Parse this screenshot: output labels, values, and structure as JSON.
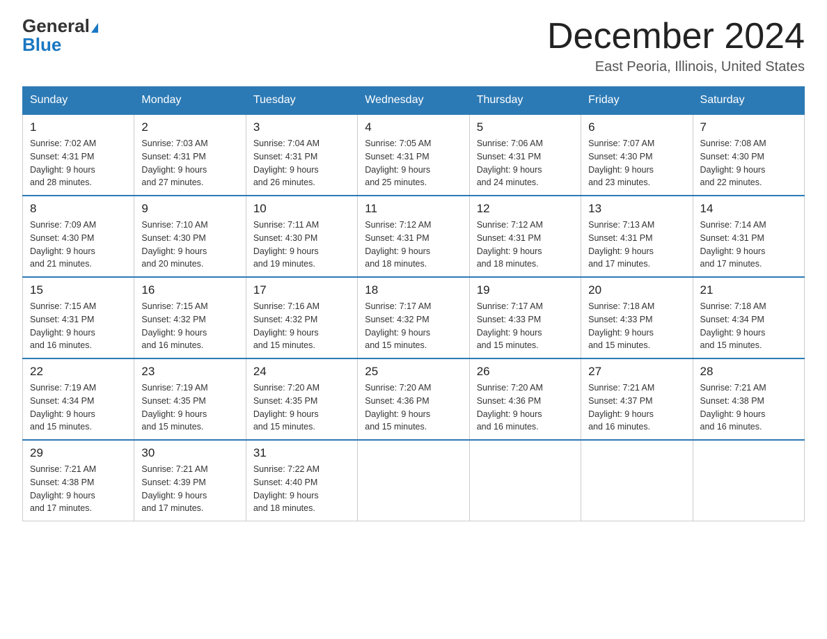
{
  "logo": {
    "general": "General",
    "blue": "Blue"
  },
  "header": {
    "month": "December 2024",
    "location": "East Peoria, Illinois, United States"
  },
  "days_of_week": [
    "Sunday",
    "Monday",
    "Tuesday",
    "Wednesday",
    "Thursday",
    "Friday",
    "Saturday"
  ],
  "weeks": [
    [
      {
        "day": "1",
        "sunrise": "7:02 AM",
        "sunset": "4:31 PM",
        "daylight": "9 hours and 28 minutes."
      },
      {
        "day": "2",
        "sunrise": "7:03 AM",
        "sunset": "4:31 PM",
        "daylight": "9 hours and 27 minutes."
      },
      {
        "day": "3",
        "sunrise": "7:04 AM",
        "sunset": "4:31 PM",
        "daylight": "9 hours and 26 minutes."
      },
      {
        "day": "4",
        "sunrise": "7:05 AM",
        "sunset": "4:31 PM",
        "daylight": "9 hours and 25 minutes."
      },
      {
        "day": "5",
        "sunrise": "7:06 AM",
        "sunset": "4:31 PM",
        "daylight": "9 hours and 24 minutes."
      },
      {
        "day": "6",
        "sunrise": "7:07 AM",
        "sunset": "4:30 PM",
        "daylight": "9 hours and 23 minutes."
      },
      {
        "day": "7",
        "sunrise": "7:08 AM",
        "sunset": "4:30 PM",
        "daylight": "9 hours and 22 minutes."
      }
    ],
    [
      {
        "day": "8",
        "sunrise": "7:09 AM",
        "sunset": "4:30 PM",
        "daylight": "9 hours and 21 minutes."
      },
      {
        "day": "9",
        "sunrise": "7:10 AM",
        "sunset": "4:30 PM",
        "daylight": "9 hours and 20 minutes."
      },
      {
        "day": "10",
        "sunrise": "7:11 AM",
        "sunset": "4:30 PM",
        "daylight": "9 hours and 19 minutes."
      },
      {
        "day": "11",
        "sunrise": "7:12 AM",
        "sunset": "4:31 PM",
        "daylight": "9 hours and 18 minutes."
      },
      {
        "day": "12",
        "sunrise": "7:12 AM",
        "sunset": "4:31 PM",
        "daylight": "9 hours and 18 minutes."
      },
      {
        "day": "13",
        "sunrise": "7:13 AM",
        "sunset": "4:31 PM",
        "daylight": "9 hours and 17 minutes."
      },
      {
        "day": "14",
        "sunrise": "7:14 AM",
        "sunset": "4:31 PM",
        "daylight": "9 hours and 17 minutes."
      }
    ],
    [
      {
        "day": "15",
        "sunrise": "7:15 AM",
        "sunset": "4:31 PM",
        "daylight": "9 hours and 16 minutes."
      },
      {
        "day": "16",
        "sunrise": "7:15 AM",
        "sunset": "4:32 PM",
        "daylight": "9 hours and 16 minutes."
      },
      {
        "day": "17",
        "sunrise": "7:16 AM",
        "sunset": "4:32 PM",
        "daylight": "9 hours and 15 minutes."
      },
      {
        "day": "18",
        "sunrise": "7:17 AM",
        "sunset": "4:32 PM",
        "daylight": "9 hours and 15 minutes."
      },
      {
        "day": "19",
        "sunrise": "7:17 AM",
        "sunset": "4:33 PM",
        "daylight": "9 hours and 15 minutes."
      },
      {
        "day": "20",
        "sunrise": "7:18 AM",
        "sunset": "4:33 PM",
        "daylight": "9 hours and 15 minutes."
      },
      {
        "day": "21",
        "sunrise": "7:18 AM",
        "sunset": "4:34 PM",
        "daylight": "9 hours and 15 minutes."
      }
    ],
    [
      {
        "day": "22",
        "sunrise": "7:19 AM",
        "sunset": "4:34 PM",
        "daylight": "9 hours and 15 minutes."
      },
      {
        "day": "23",
        "sunrise": "7:19 AM",
        "sunset": "4:35 PM",
        "daylight": "9 hours and 15 minutes."
      },
      {
        "day": "24",
        "sunrise": "7:20 AM",
        "sunset": "4:35 PM",
        "daylight": "9 hours and 15 minutes."
      },
      {
        "day": "25",
        "sunrise": "7:20 AM",
        "sunset": "4:36 PM",
        "daylight": "9 hours and 15 minutes."
      },
      {
        "day": "26",
        "sunrise": "7:20 AM",
        "sunset": "4:36 PM",
        "daylight": "9 hours and 16 minutes."
      },
      {
        "day": "27",
        "sunrise": "7:21 AM",
        "sunset": "4:37 PM",
        "daylight": "9 hours and 16 minutes."
      },
      {
        "day": "28",
        "sunrise": "7:21 AM",
        "sunset": "4:38 PM",
        "daylight": "9 hours and 16 minutes."
      }
    ],
    [
      {
        "day": "29",
        "sunrise": "7:21 AM",
        "sunset": "4:38 PM",
        "daylight": "9 hours and 17 minutes."
      },
      {
        "day": "30",
        "sunrise": "7:21 AM",
        "sunset": "4:39 PM",
        "daylight": "9 hours and 17 minutes."
      },
      {
        "day": "31",
        "sunrise": "7:22 AM",
        "sunset": "4:40 PM",
        "daylight": "9 hours and 18 minutes."
      },
      null,
      null,
      null,
      null
    ]
  ],
  "labels": {
    "sunrise_prefix": "Sunrise: ",
    "sunset_prefix": "Sunset: ",
    "daylight_prefix": "Daylight: "
  }
}
